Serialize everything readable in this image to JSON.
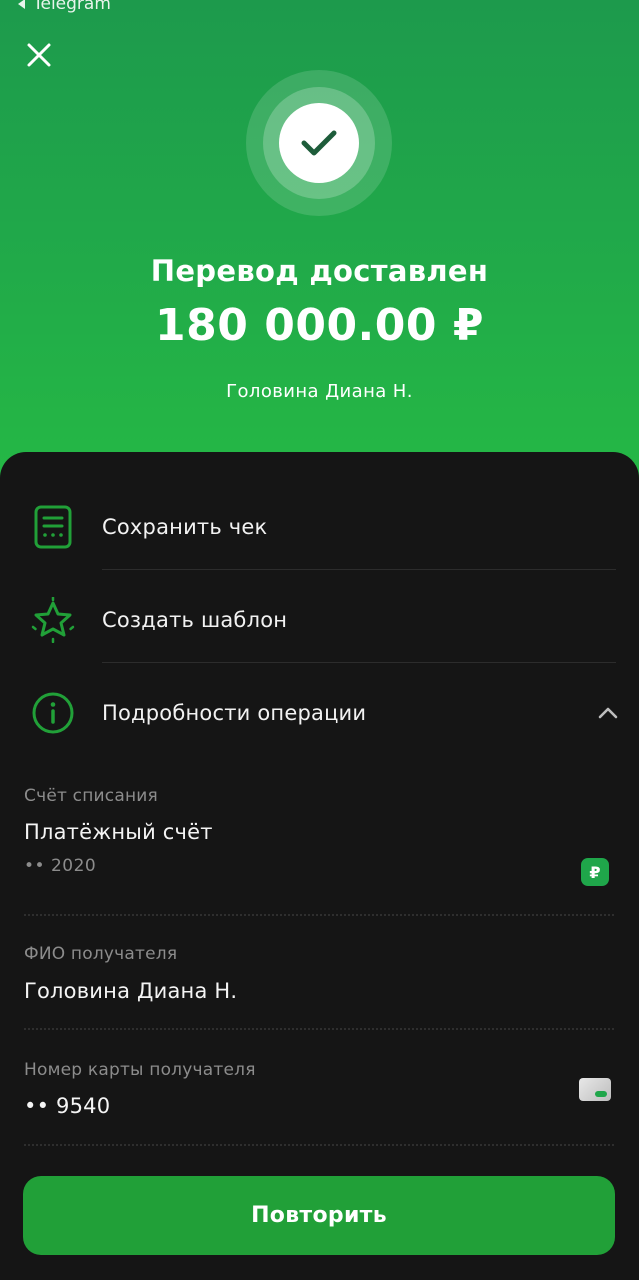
{
  "status_bar": {
    "back_label": "Telegram"
  },
  "header": {
    "title": "Перевод доставлен",
    "amount": "180 000.00 ₽",
    "recipient": "Головина Диана Н."
  },
  "actions": [
    {
      "label": "Сохранить чек",
      "icon": "receipt-icon"
    },
    {
      "label": "Создать шаблон",
      "icon": "star-icon"
    },
    {
      "label": "Подробности операции",
      "icon": "info-icon"
    }
  ],
  "details": {
    "source_account": {
      "label": "Счёт списания",
      "value": "Платёжный счёт",
      "sub": "•• 2020",
      "badge": "₽"
    },
    "recipient_name": {
      "label": "ФИО получателя",
      "value": "Головина Диана Н."
    },
    "recipient_card": {
      "label": "Номер карты получателя",
      "value": "•• 9540"
    }
  },
  "repeat_button": {
    "label": "Повторить"
  },
  "colors": {
    "accent": "#21a038",
    "hero_top": "#1d9a4c",
    "hero_bottom": "#25b845",
    "sheet_bg": "#151515"
  }
}
